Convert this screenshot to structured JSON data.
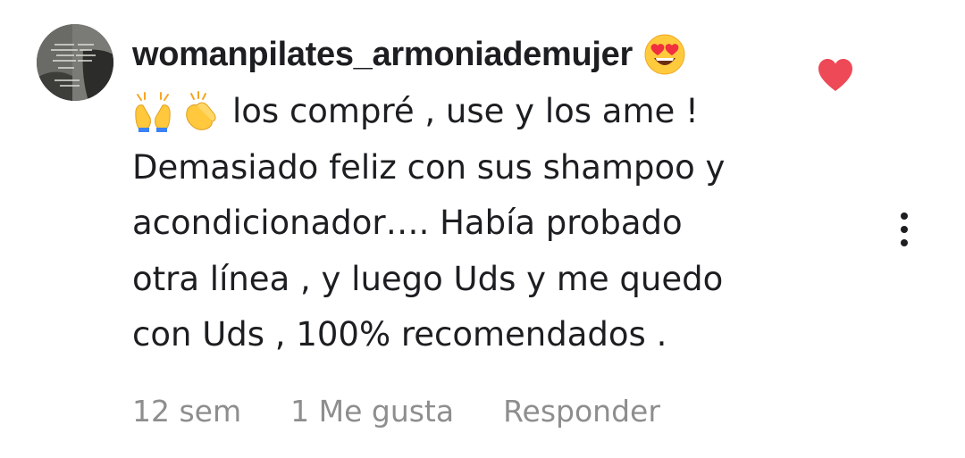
{
  "comment": {
    "username": "womanpilates_armoniademujer",
    "username_emoji": "heart-eyes-emoji",
    "body_emojis": [
      "raising-hands-emoji",
      "clapping-hands-emoji"
    ],
    "body_lines": [
      "los compré , use y los ame !",
      "Demasiado feliz con sus shampoo y",
      "acondicionador…. Había probado",
      "otra línea , y luego Uds y me quedo",
      "con Uds , 100% recomendados ."
    ],
    "time": "12 sem",
    "likes": "1 Me gusta",
    "reply_label": "Responder",
    "liked": true,
    "heart_color": "#ed4956",
    "meta_color": "#8e8e8e",
    "text_color": "#1c1e21"
  }
}
